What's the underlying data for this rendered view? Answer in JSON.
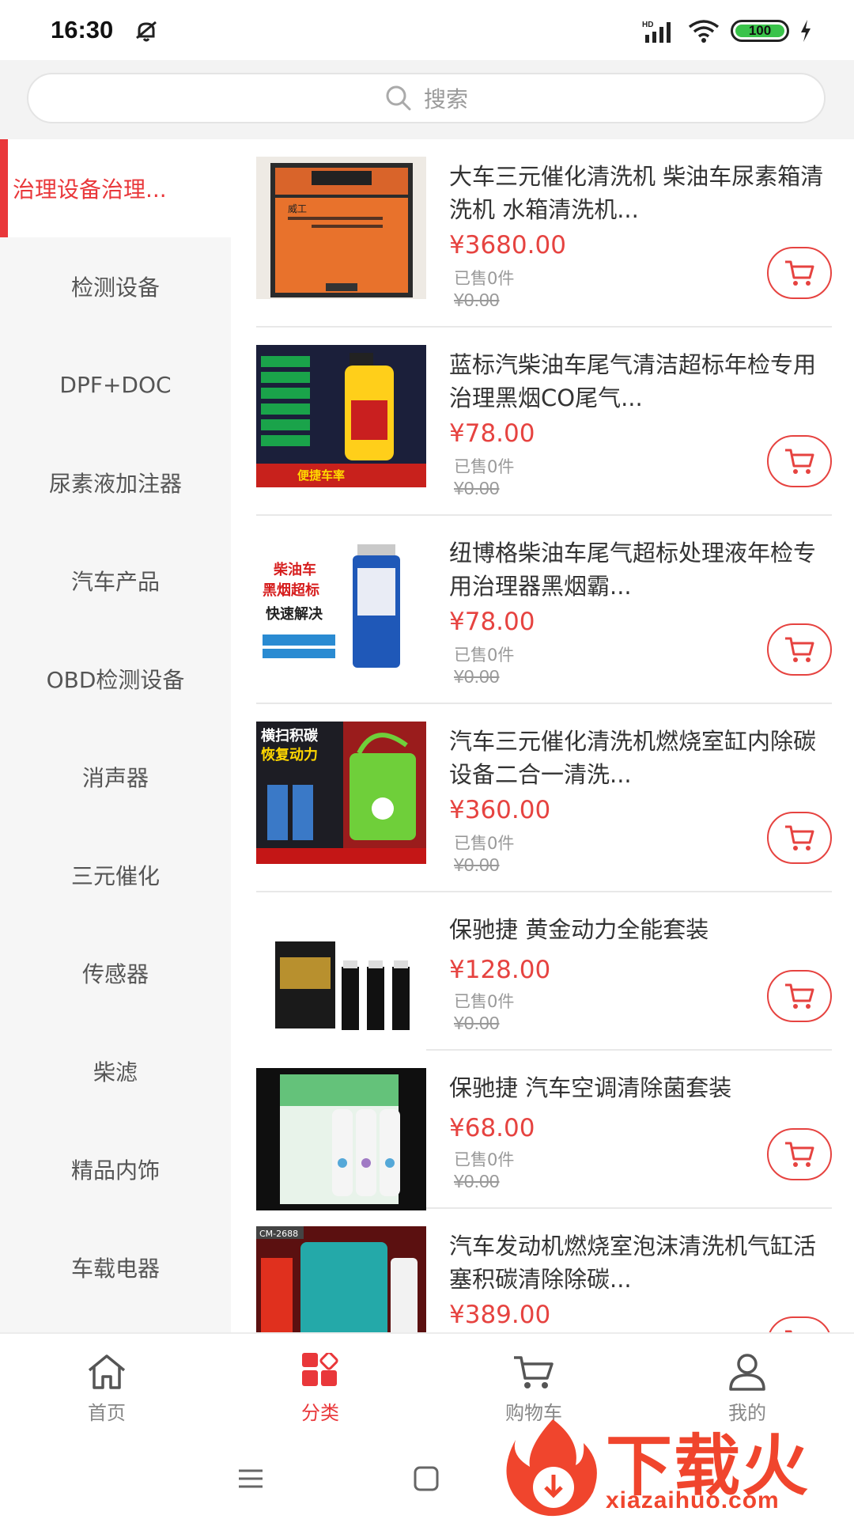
{
  "status": {
    "time": "16:30",
    "network": "HD",
    "battery": "100"
  },
  "search": {
    "placeholder": "搜索"
  },
  "sidebar": {
    "items": [
      {
        "label": "治理设备治理..."
      },
      {
        "label": "检测设备"
      },
      {
        "label": "DPF+DOC"
      },
      {
        "label": "尿素液加注器"
      },
      {
        "label": "汽车产品"
      },
      {
        "label": "OBD检测设备"
      },
      {
        "label": "消声器"
      },
      {
        "label": "三元催化"
      },
      {
        "label": "传感器"
      },
      {
        "label": "柴滤"
      },
      {
        "label": "精品内饰"
      },
      {
        "label": "车载电器"
      }
    ]
  },
  "products": [
    {
      "title": "大车三元催化清洗机 柴油车尿素箱清洗机 水箱清洗机...",
      "price": "¥3680.00",
      "sold": "已售0件",
      "original": "¥0.00",
      "image_text": "威工"
    },
    {
      "title": "蓝标汽柴油车尾气清洁超标年检专用治理黑烟CO尾气...",
      "price": "¥78.00",
      "sold": "已售0件",
      "original": "¥0.00",
      "image_text": "便捷车率"
    },
    {
      "title": "纽博格柴油车尾气超标处理液年检专用治理器黑烟霸...",
      "price": "¥78.00",
      "sold": "已售0件",
      "original": "¥0.00",
      "image_text_1": "柴油车",
      "image_text_2": "黑烟超标",
      "image_text_3": "快速解决"
    },
    {
      "title": "汽车三元催化清洗机燃烧室缸内除碳设备二合一清洗...",
      "price": "¥360.00",
      "sold": "已售0件",
      "original": "¥0.00",
      "image_text_1": "横扫积碳",
      "image_text_2": "恢复动力"
    },
    {
      "title": "保驰捷 黄金动力全能套装",
      "price": "¥128.00",
      "sold": "已售0件",
      "original": "¥0.00"
    },
    {
      "title": "保驰捷 汽车空调清除菌套装",
      "price": "¥68.00",
      "sold": "已售0件",
      "original": "¥0.00"
    },
    {
      "title": "汽车发动机燃烧室泡沫清洗机气缸活塞积碳清除除碳...",
      "price": "¥389.00",
      "image_text": "CM-2688"
    }
  ],
  "tabbar": {
    "tabs": [
      {
        "label": "首页",
        "icon": "home-icon"
      },
      {
        "label": "分类",
        "icon": "category-icon",
        "active": true
      },
      {
        "label": "购物车",
        "icon": "cart-icon"
      },
      {
        "label": "我的",
        "icon": "user-icon"
      }
    ]
  },
  "watermark": {
    "text": "下载火",
    "url": "xiazaihuo.com"
  },
  "colors": {
    "accent": "#e9373a",
    "price": "#e64340",
    "sidebar_bg": "#f6f6f6"
  }
}
